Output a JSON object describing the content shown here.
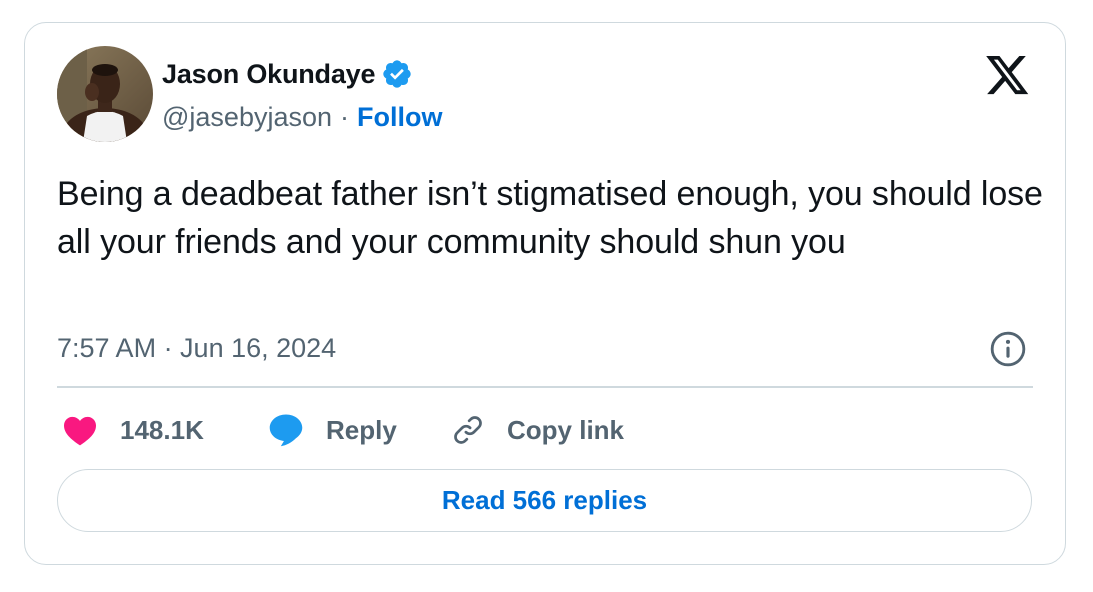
{
  "author": {
    "name": "Jason Okundaye",
    "handle": "@jasebyjason",
    "separator": "·",
    "follow_label": "Follow",
    "verified_icon": "verified-badge-icon",
    "verified_color": "#1d9bf0"
  },
  "tweet": {
    "text": "Being a deadbeat father isn’t stigmatised enough, you should lose all your friends and your community should shun you",
    "timestamp": "7:57 AM · Jun 16, 2024"
  },
  "actions": {
    "like_count": "148.1K",
    "like_icon": "heart-icon",
    "like_color": "#f91880",
    "reply_label": "Reply",
    "reply_icon": "speech-bubble-icon",
    "reply_color": "#1d9bf0",
    "copy_label": "Copy link",
    "copy_icon": "link-icon"
  },
  "read_replies_label": "Read 566 replies",
  "platform_logo": "x-logo",
  "colors": {
    "text_primary": "#0f1419",
    "text_secondary": "#536471",
    "link_blue": "#006fd6",
    "border": "#cfd9de"
  }
}
